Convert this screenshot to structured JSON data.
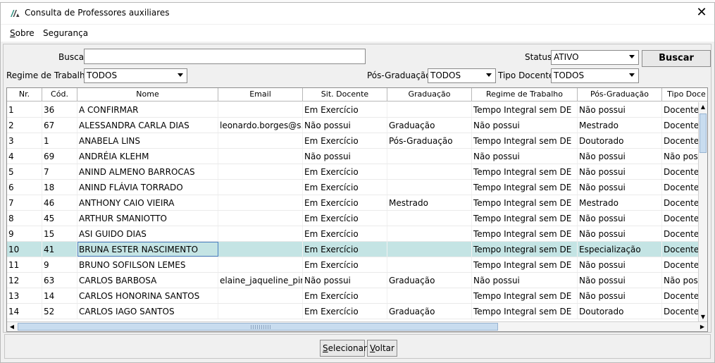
{
  "window": {
    "title": "Consulta de Professores auxiliares",
    "close_glyph": "✕"
  },
  "menu": {
    "items": [
      {
        "mnemonic": "S",
        "rest": "obre"
      },
      {
        "label": "Segurança"
      }
    ]
  },
  "filters": {
    "busca_label": "Busca:",
    "busca_value": "",
    "status_label": "Status:",
    "status_value": "ATIVO",
    "buscar_label": "Buscar",
    "regime_label": "Regime de Trabalho:",
    "regime_value": "TODOS",
    "pos_label": "Pós-Graduação:",
    "pos_value": "TODOS",
    "tipo_label": "Tipo Docente:",
    "tipo_value": "TODOS"
  },
  "table": {
    "columns": [
      "Nr.",
      "Cód.",
      "Nome",
      "Email",
      "Sit. Docente",
      "Graduação",
      "Regime de Trabalho",
      "Pós-Graduação",
      "Tipo Doce"
    ],
    "rows": [
      [
        "1",
        "36",
        "A CONFIRMAR",
        "",
        "Em Exercício",
        "",
        "Tempo Integral sem DE",
        "Não possui",
        "Docente"
      ],
      [
        "2",
        "67",
        "ALESSANDRA CARLA DIAS",
        "leonardo.borges@s...",
        "Não possui",
        "Graduação",
        "Não possui",
        "Mestrado",
        "Docente/T"
      ],
      [
        "3",
        "1",
        "ANABELA LINS",
        "",
        "Em Exercício",
        "Pós-Graduação",
        "Tempo Integral sem DE",
        "Doutorado",
        "Docente"
      ],
      [
        "4",
        "69",
        "ANDRÉIA KLEHM",
        "",
        "Não possui",
        "",
        "Não possui",
        "Não possui",
        "Não possu"
      ],
      [
        "5",
        "7",
        "ANIND ALMENO BARROCAS",
        "",
        "Em Exercício",
        "",
        "Tempo Integral sem DE",
        "Não possui",
        "Docente"
      ],
      [
        "6",
        "18",
        "ANIND FLÁVIA TORRADO",
        "",
        "Em Exercício",
        "",
        "Tempo Integral sem DE",
        "Não possui",
        "Docente"
      ],
      [
        "7",
        "46",
        "ANTHONY CAIO VIEIRA",
        "",
        "Em Exercício",
        "Mestrado",
        "Tempo Integral sem DE",
        "Mestrado",
        "Docente"
      ],
      [
        "8",
        "45",
        "ARTHUR SMANIOTTO",
        "",
        "Em Exercício",
        "",
        "Tempo Integral sem DE",
        "Não possui",
        "Docente"
      ],
      [
        "9",
        "15",
        "ASI GUIDO DIAS",
        "",
        "Em Exercício",
        "",
        "Tempo Integral sem DE",
        "Não possui",
        "Docente"
      ],
      [
        "10",
        "41",
        "BRUNA ESTER NASCIMENTO",
        "",
        "Em Exercício",
        "",
        "Tempo Integral sem DE",
        "Especialização",
        "Docente"
      ],
      [
        "11",
        "9",
        "BRUNO SOFILSON LEMES",
        "",
        "Em Exercício",
        "",
        "Tempo Integral sem DE",
        "Não possui",
        "Docente"
      ],
      [
        "12",
        "63",
        "CARLOS BARBOSA",
        "elaine_jaqueline_pir...",
        "Não possui",
        "Graduação",
        "Não possui",
        "Não possui",
        "Não possu"
      ],
      [
        "13",
        "14",
        "CARLOS HONORINA SANTOS",
        "",
        "Em Exercício",
        "",
        "Tempo Integral sem DE",
        "Não possui",
        "Docente"
      ],
      [
        "14",
        "52",
        "CARLOS IAGO SANTOS",
        "",
        "Em Exercício",
        "Graduação",
        "Tempo Integral sem DE",
        "Doutorado",
        "Docente"
      ]
    ],
    "selected_row_index": 9,
    "selection_color": "#c4e4e4"
  },
  "footer": {
    "selecionar": {
      "mnemonic": "S",
      "rest": "elecionar"
    },
    "voltar": {
      "mnemonic": "V",
      "rest": "oltar"
    }
  },
  "icons": {
    "app": "app-logo-icon",
    "close": "close-icon"
  }
}
